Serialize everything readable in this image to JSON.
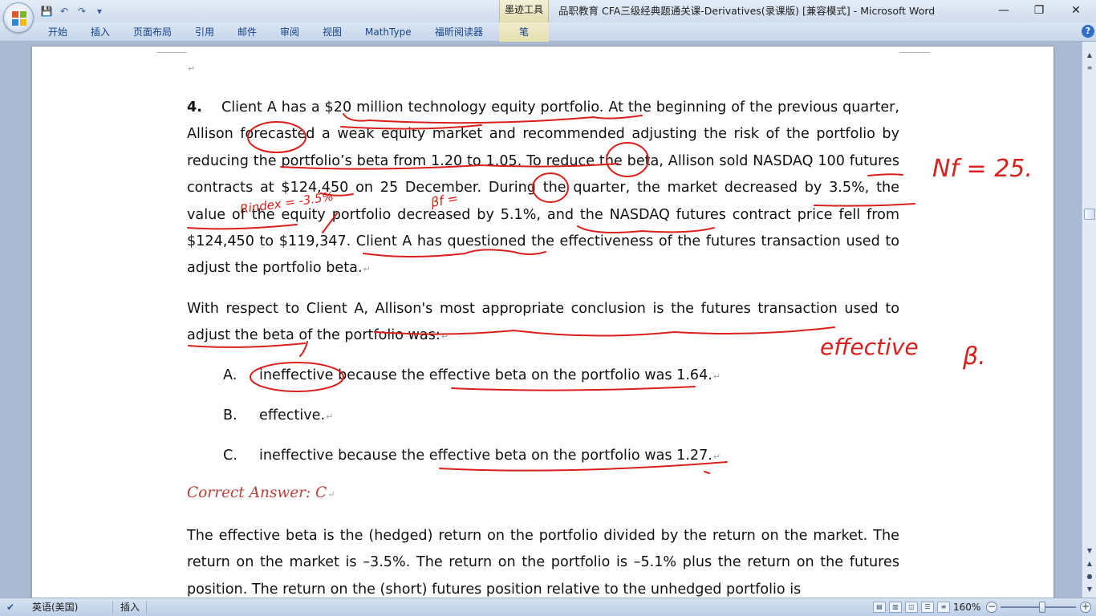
{
  "window": {
    "title": "品职教育 CFA三级经典题通关课-Derivatives(录课版) [兼容模式] - Microsoft Word",
    "context_tab_group": "墨迹工具",
    "controls": {
      "minimize": "—",
      "restore": "❐",
      "close": "✕"
    }
  },
  "quick_access": {
    "save": "💾",
    "undo": "↶",
    "redo": "↷",
    "customize": "▾"
  },
  "ribbon": {
    "tabs": [
      "开始",
      "插入",
      "页面布局",
      "引用",
      "邮件",
      "审阅",
      "视图",
      "MathType",
      "福昕阅读器",
      "笔"
    ],
    "help": "?"
  },
  "document": {
    "top_paragraph_mark": "↵",
    "question": {
      "number": "4.",
      "stem": "Client A has a $20 million technology equity portfolio. At the beginning of the previous quarter, Allison forecasted a weak equity market and recommended adjusting the risk of the portfolio by reducing the portfolio’s beta from 1.20 to 1.05. To reduce the beta, Allison sold NASDAQ 100 futures contracts at $124,450 on 25 December. During the quarter, the market decreased by 3.5%, the value of the equity portfolio decreased by 5.1%, and the NASDAQ futures contract price fell from $124,450 to $119,347. Client A has questioned the effectiveness of the futures transaction used to adjust the portfolio beta.",
      "prompt": "With respect to Client A, Allison's most appropriate conclusion is the futures transaction used to adjust the beta of the portfolio was:"
    },
    "options": [
      {
        "letter": "A.",
        "text": "ineffective because the effective beta on the portfolio was 1.64."
      },
      {
        "letter": "B.",
        "text": "effective."
      },
      {
        "letter": "C.",
        "text": "ineffective because the effective beta on the portfolio was 1.27."
      }
    ],
    "correct_answer": "Correct Answer: C",
    "explanation": "The effective beta is the (hedged) return on the portfolio divided by the return on the market. The return on the market is –3.5%. The return on the portfolio is –5.1% plus the return on the futures position. The return on the (short) futures position relative to the unhedged portfolio is",
    "paragraph_mark": "↵",
    "ink_annotations": {
      "nf": "Nf = 25.",
      "rindex": "Rindex = -3.5%",
      "bf": "βf =",
      "effective": "effective",
      "beta": "β."
    }
  },
  "statusbar": {
    "language": "英语(美国)",
    "mode": "插入",
    "zoom": "160%",
    "zoom_minus": "−",
    "zoom_plus": "+"
  },
  "colors": {
    "ink": "#d8201c",
    "answer": "#b8413a",
    "ribbon_text": "#15428b"
  }
}
